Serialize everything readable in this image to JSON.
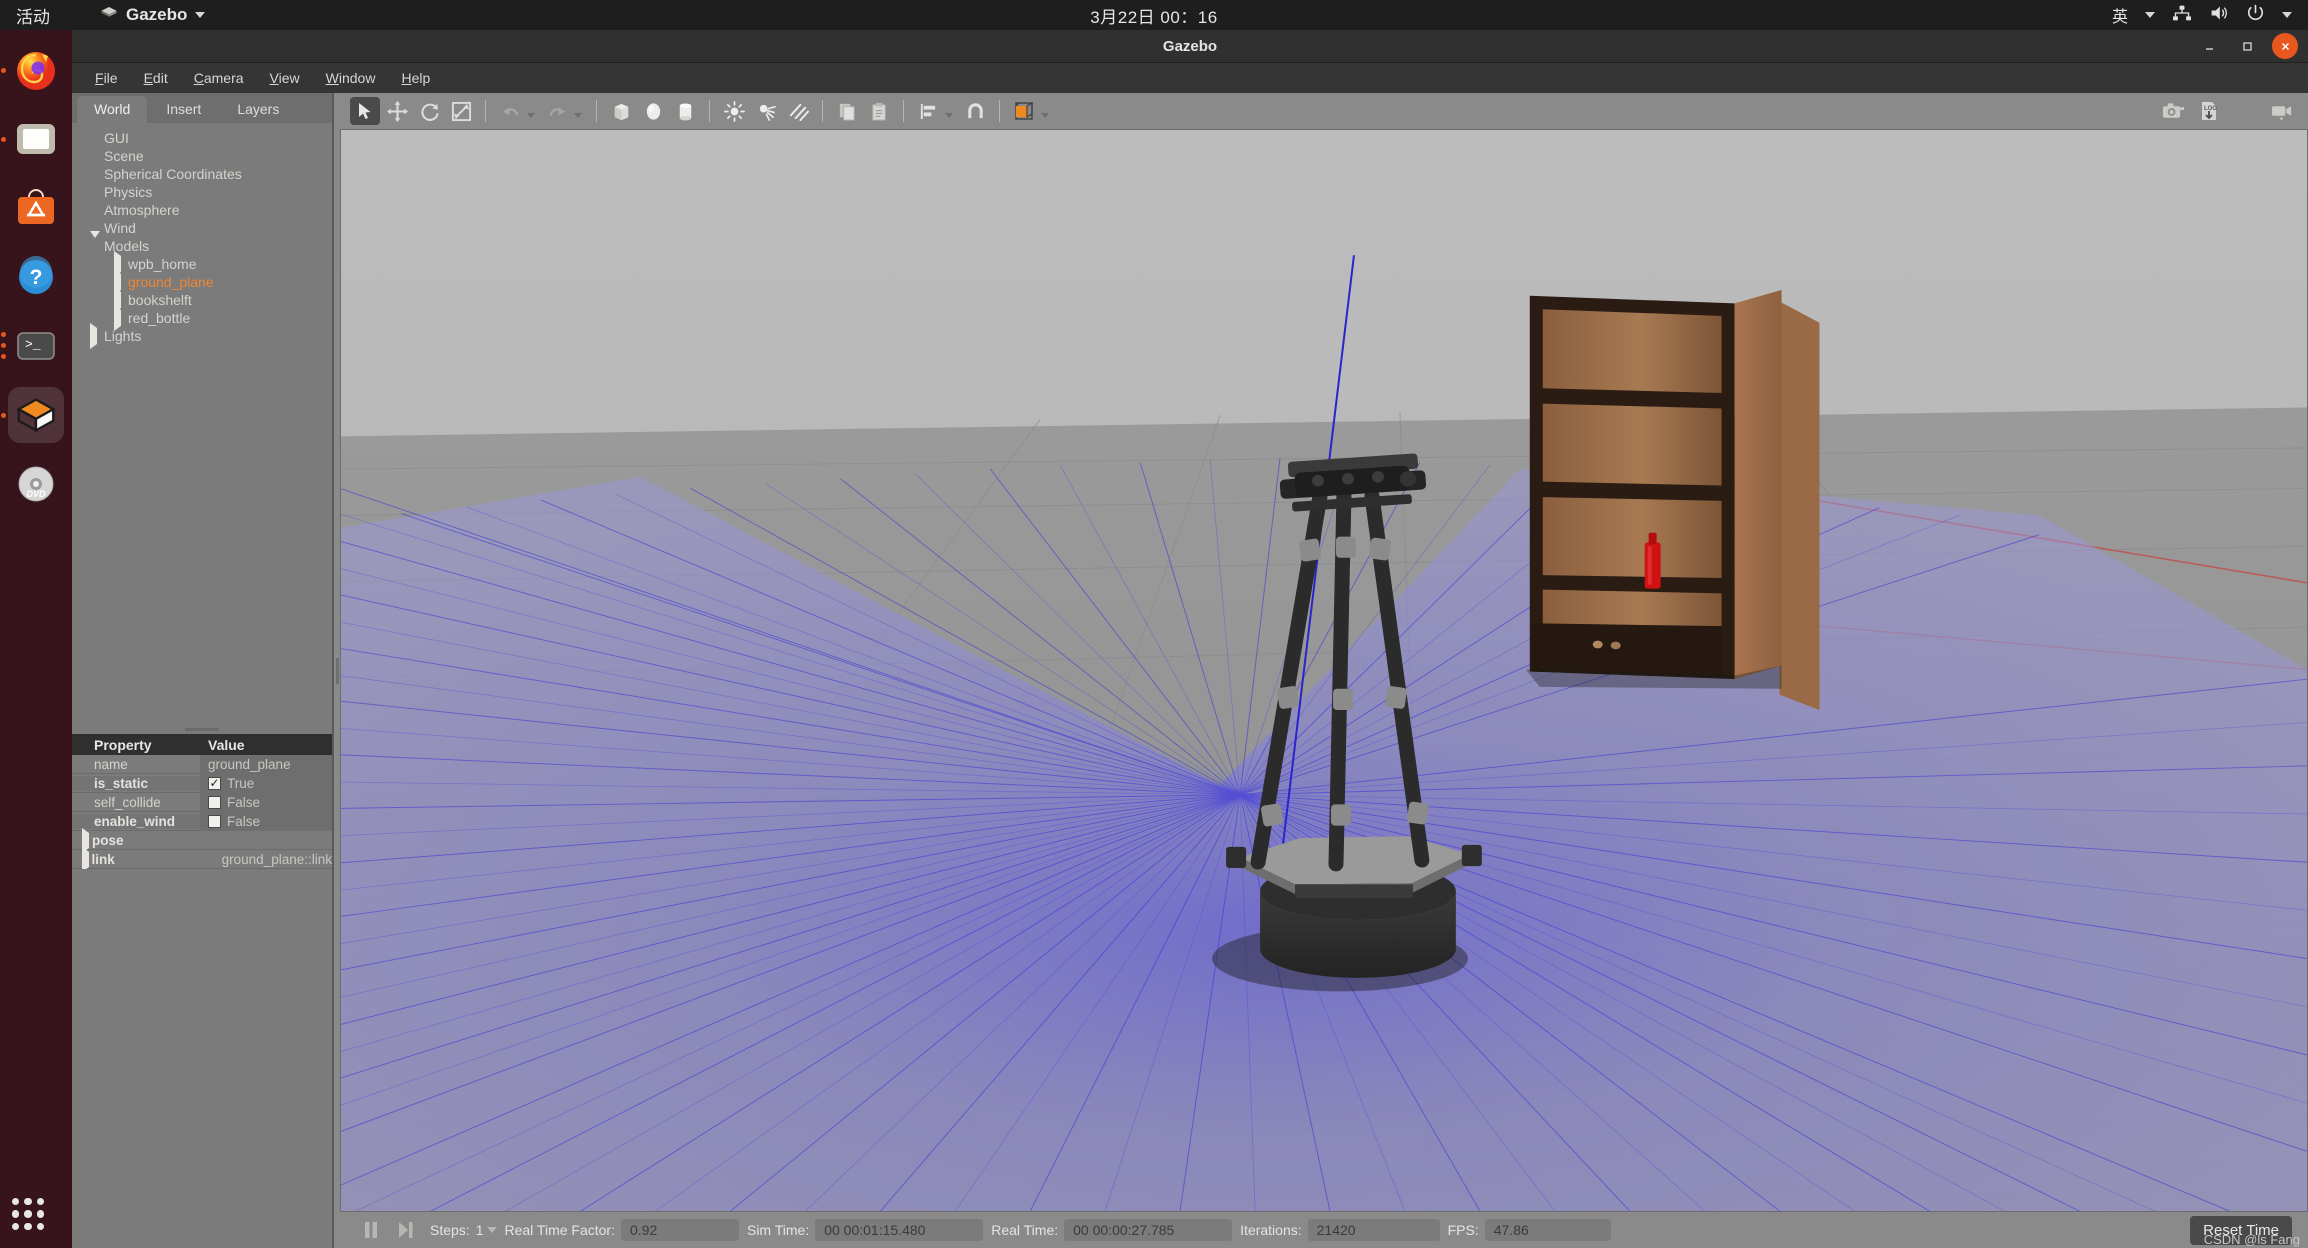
{
  "system_bar": {
    "activities": "活动",
    "app_menu": "Gazebo",
    "app_icon": "gazebo-icon",
    "clock": "3月22日  00：16",
    "input_method": "英",
    "tray_icons": [
      "network-icon",
      "volume-icon",
      "power-icon",
      "chevron-down-icon"
    ]
  },
  "dock": {
    "items": [
      {
        "name": "firefox",
        "running": true
      },
      {
        "name": "files",
        "running": true
      },
      {
        "name": "ubuntu-software",
        "running": false
      },
      {
        "name": "help",
        "running": false
      },
      {
        "name": "terminal",
        "running": true
      },
      {
        "name": "gazebo",
        "running": true,
        "active": true
      },
      {
        "name": "rhythmbox",
        "running": false
      }
    ],
    "show_apps": "show-applications"
  },
  "window": {
    "title": "Gazebo",
    "buttons": {
      "minimize": "–",
      "maximize": "❐",
      "close": "✕"
    }
  },
  "menubar": [
    {
      "label": "File",
      "mnemonic": "F"
    },
    {
      "label": "Edit",
      "mnemonic": "E"
    },
    {
      "label": "Camera",
      "mnemonic": "C"
    },
    {
      "label": "View",
      "mnemonic": "V"
    },
    {
      "label": "Window",
      "mnemonic": "W"
    },
    {
      "label": "Help",
      "mnemonic": "H"
    }
  ],
  "left_panel": {
    "tabs": [
      {
        "label": "World",
        "active": true
      },
      {
        "label": "Insert",
        "active": false
      },
      {
        "label": "Layers",
        "active": false
      }
    ],
    "tree": [
      {
        "label": "GUI",
        "level": 0,
        "expander": "none",
        "selected": false
      },
      {
        "label": "Scene",
        "level": 0,
        "expander": "none",
        "selected": false
      },
      {
        "label": "Spherical Coordinates",
        "level": 0,
        "expander": "none",
        "selected": false
      },
      {
        "label": "Physics",
        "level": 0,
        "expander": "none",
        "selected": false
      },
      {
        "label": "Atmosphere",
        "level": 0,
        "expander": "none",
        "selected": false
      },
      {
        "label": "Wind",
        "level": 0,
        "expander": "none",
        "selected": false
      },
      {
        "label": "Models",
        "level": 0,
        "expander": "down",
        "selected": false
      },
      {
        "label": "wpb_home",
        "level": 1,
        "expander": "right",
        "selected": false
      },
      {
        "label": "ground_plane",
        "level": 1,
        "expander": "right",
        "selected": true
      },
      {
        "label": "bookshelft",
        "level": 1,
        "expander": "right",
        "selected": false
      },
      {
        "label": "red_bottle",
        "level": 1,
        "expander": "right",
        "selected": false
      },
      {
        "label": "Lights",
        "level": 0,
        "expander": "right",
        "selected": false
      }
    ],
    "property_table": {
      "headers": {
        "property": "Property",
        "value": "Value"
      },
      "rows": [
        {
          "key": "name",
          "value": "ground_plane",
          "type": "text",
          "bold": false
        },
        {
          "key": "is_static",
          "value": "True",
          "type": "checkbox",
          "checked": true,
          "bold": true
        },
        {
          "key": "self_collide",
          "value": "False",
          "type": "checkbox",
          "checked": false,
          "bold": false
        },
        {
          "key": "enable_wind",
          "value": "False",
          "type": "checkbox",
          "checked": false,
          "bold": true
        }
      ],
      "expandable": [
        {
          "key": "pose",
          "value": ""
        },
        {
          "key": "link",
          "value": "ground_plane::link"
        }
      ]
    }
  },
  "toolbar": {
    "buttons": [
      {
        "name": "select-mode-icon",
        "active": true
      },
      {
        "name": "translate-mode-icon",
        "active": false
      },
      {
        "name": "rotate-mode-icon",
        "active": false
      },
      {
        "name": "scale-mode-icon",
        "active": false
      },
      {
        "name": "undo-icon",
        "active": false
      },
      {
        "name": "redo-icon",
        "active": false
      },
      {
        "name": "insert-box-icon",
        "active": false
      },
      {
        "name": "insert-sphere-icon",
        "active": false
      },
      {
        "name": "insert-cylinder-icon",
        "active": false
      },
      {
        "name": "point-light-icon",
        "active": false
      },
      {
        "name": "spot-light-icon",
        "active": false
      },
      {
        "name": "directional-light-icon",
        "active": false
      },
      {
        "name": "copy-icon",
        "active": false
      },
      {
        "name": "paste-icon",
        "active": false
      },
      {
        "name": "align-icon",
        "active": false
      },
      {
        "name": "snap-icon",
        "active": false
      },
      {
        "name": "view-angle-icon",
        "active": false
      }
    ],
    "right_icons": [
      {
        "name": "screenshot-icon"
      },
      {
        "name": "log-icon",
        "text": "LOG"
      },
      {
        "name": "plot-icon"
      },
      {
        "name": "video-record-icon"
      }
    ]
  },
  "status_bar": {
    "pause_icon": "pause-icon",
    "step_icon": "step-forward-icon",
    "steps_label": "Steps:",
    "steps_value": "1",
    "real_time_factor_label": "Real Time Factor:",
    "real_time_factor_value": "0.92",
    "sim_time_label": "Sim Time:",
    "sim_time_value": "00 00:01:15.480",
    "real_time_label": "Real Time:",
    "real_time_value": "00 00:00:27.785",
    "iterations_label": "Iterations:",
    "iterations_value": "21420",
    "fps_label": "FPS:",
    "fps_value": "47.86",
    "reset_button": "Reset Time"
  },
  "viewport": {
    "scene_objects": [
      {
        "name": "ground-plane",
        "type": "plane"
      },
      {
        "name": "wpb-home-robot",
        "type": "model"
      },
      {
        "name": "bookshelf",
        "type": "model"
      },
      {
        "name": "red-bottle",
        "type": "model"
      },
      {
        "name": "laser-scan-fan",
        "type": "sensor-visual"
      }
    ],
    "colors": {
      "sky": "#b6b6b6",
      "ground": "#959595",
      "laser_blue": "#3a36d8",
      "laser_fill": "#8e8ad8",
      "axis_x_red": "#c23b3b",
      "wood_light": "#a9754e",
      "wood_dark": "#2c1d14",
      "bottle_red": "#d41414",
      "robot_dark": "#2b2b2b",
      "robot_gray": "#8e8e8e"
    }
  },
  "watermark": "CSDN @ls Fang"
}
